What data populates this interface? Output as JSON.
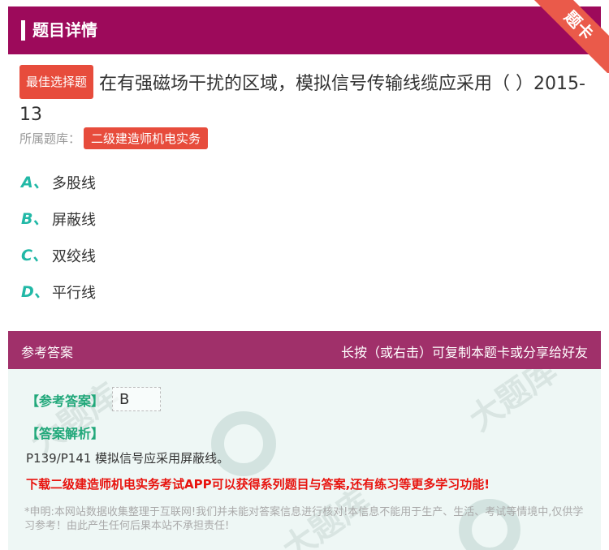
{
  "header": {
    "title": "题目详情",
    "ribbon": "题卡"
  },
  "question": {
    "badge": "最佳选择题",
    "text": "在有强磁场干扰的区域，模拟信号传输线缆应采用（ ）2015-13",
    "source_label": "所属题库：",
    "source_tag": "二级建造师机电实务"
  },
  "options": [
    {
      "letter": "A、",
      "text": "多股线"
    },
    {
      "letter": "B、",
      "text": "屏蔽线"
    },
    {
      "letter": "C、",
      "text": "双绞线"
    },
    {
      "letter": "D、",
      "text": "平行线"
    }
  ],
  "answer_section": {
    "title": "参考答案",
    "hint": "长按（或右击）可复制本题卡或分享给好友",
    "answer_label": "【参考答案】",
    "answer_value": "B",
    "explanation_label": "【答案解析】",
    "explanation": "P139/P141 模拟信号应采用屏蔽线。",
    "promo": "下载二级建造师机电实务考试APP可以获得系列题目与答案,还有练习等更多学习功能!",
    "disclaimer": "*申明:本网站数据收集整理于互联网!我们并未能对答案信息进行核对!本信息不能用于生产、生活、考试等情境中,仅供学习参考！由此产生任何后果本站不承担责任!"
  },
  "colors": {
    "header": "#9d0a5b",
    "ribbon": "#ea5a4a",
    "badge": "#e74c3c",
    "option_letter": "#21b8a6",
    "promo": "#e8140f"
  }
}
